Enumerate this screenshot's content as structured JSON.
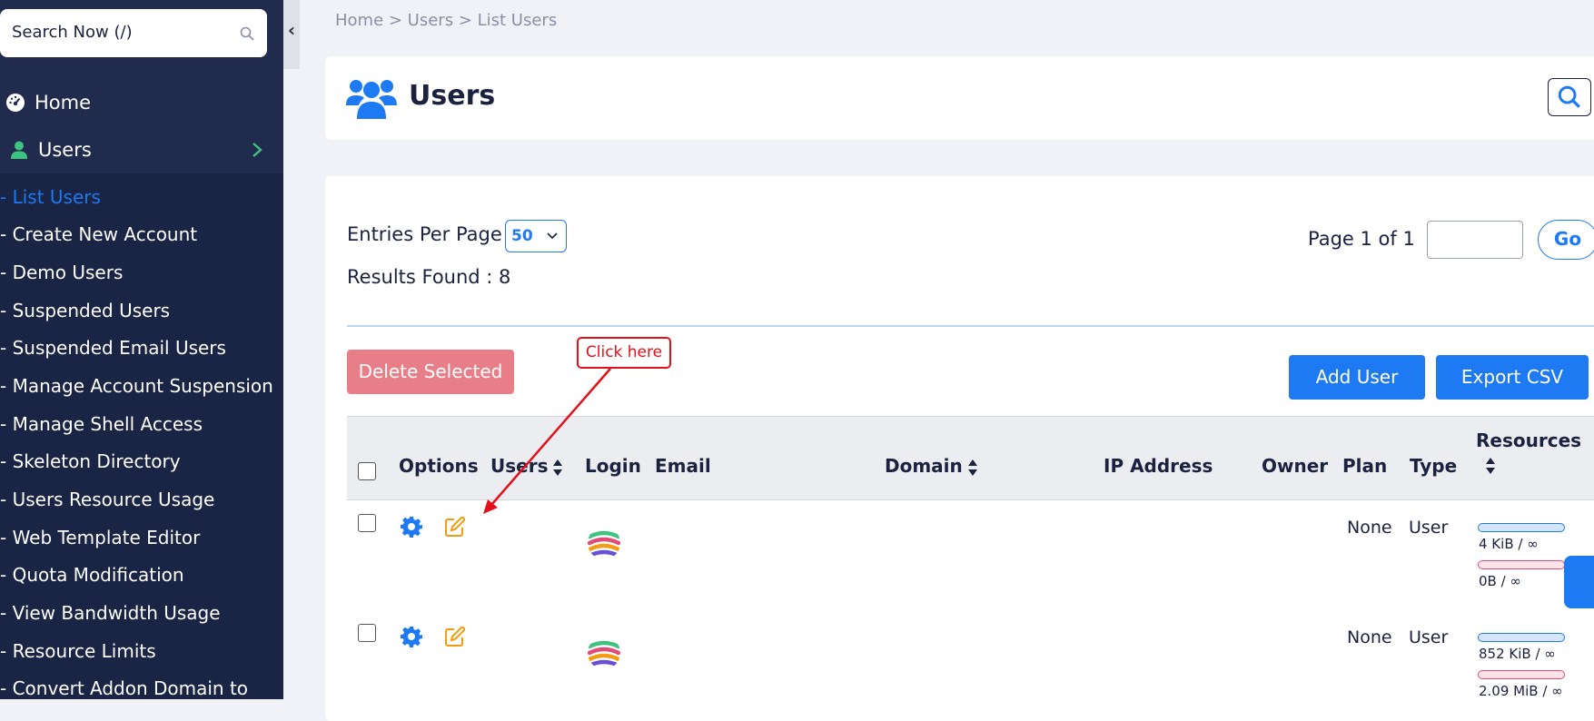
{
  "sidebar": {
    "search_placeholder": "Search Now (/)",
    "home_label": "Home",
    "users_label": "Users",
    "submenu": [
      "- List Users",
      "- Create New Account",
      "- Demo Users",
      "- Suspended Users",
      "- Suspended Email Users",
      "- Manage Account Suspension",
      "- Manage Shell Access",
      "- Skeleton Directory",
      "- Users Resource Usage",
      "- Web Template Editor",
      "- Quota Modification",
      "- View Bandwidth Usage",
      "- Resource Limits",
      "- Convert Addon Domain to"
    ],
    "collapse_glyph": "‹"
  },
  "breadcrumb": "Home > Users > List Users",
  "page": {
    "title": "Users"
  },
  "controls": {
    "entries_label": "Entries Per Page",
    "entries_value": "50",
    "results_label": "Results Found : 8",
    "page_label": "Page 1 of 1",
    "go_label": "Go",
    "delete_label": "Delete Selected",
    "add_user_label": "Add User",
    "export_label": "Export CSV"
  },
  "table": {
    "headers": {
      "options": "Options",
      "users": "Users",
      "login": "Login",
      "email": "Email",
      "domain": "Domain",
      "ip": "IP Address",
      "owner": "Owner",
      "plan": "Plan",
      "type": "Type",
      "resources": "Resources"
    },
    "rows": [
      {
        "plan": "None",
        "type": "User",
        "disk": "4 KiB / ∞",
        "bandwidth": "0B / ∞"
      },
      {
        "plan": "None",
        "type": "User",
        "disk": "852 KiB / ∞",
        "bandwidth": "2.09 MiB / ∞"
      }
    ]
  },
  "annotation": {
    "callout": "Click here"
  },
  "colors": {
    "sidebar_bg": "#202b4e",
    "accent": "#1d7af3",
    "delete_btn": "#e87f88",
    "annotation_red": "#e3101a"
  }
}
